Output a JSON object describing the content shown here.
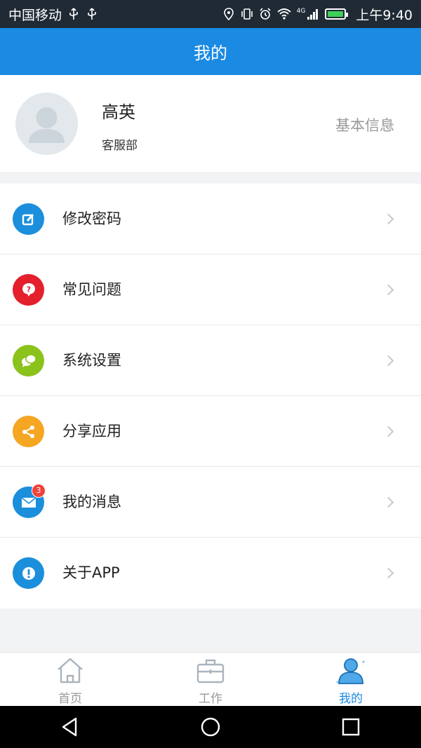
{
  "status_bar": {
    "carrier": "中国移动",
    "network": "4G",
    "time": "上午9:40"
  },
  "header": {
    "title": "我的"
  },
  "profile": {
    "name": "高英",
    "department": "客服部",
    "info_link": "基本信息"
  },
  "menu": {
    "items": [
      {
        "label": "修改密码",
        "icon": "edit-icon",
        "color": "#1b8fdc"
      },
      {
        "label": "常见问题",
        "icon": "question-icon",
        "color": "#e3202b"
      },
      {
        "label": "系统设置",
        "icon": "chat-icon",
        "color": "#8bc21c"
      },
      {
        "label": "分享应用",
        "icon": "share-icon",
        "color": "#f5a623"
      },
      {
        "label": "我的消息",
        "icon": "mail-icon",
        "color": "#1b8fdc",
        "badge": "3"
      },
      {
        "label": "关于APP",
        "icon": "info-icon",
        "color": "#1b8fdc"
      }
    ]
  },
  "tabs": [
    {
      "label": "首页",
      "icon": "home-icon",
      "active": false
    },
    {
      "label": "工作",
      "icon": "briefcase-icon",
      "active": false
    },
    {
      "label": "我的",
      "icon": "person-icon",
      "active": true
    }
  ],
  "colors": {
    "primary": "#1a8ae2",
    "status_bar": "#1f2a35",
    "badge": "#f0423a"
  }
}
